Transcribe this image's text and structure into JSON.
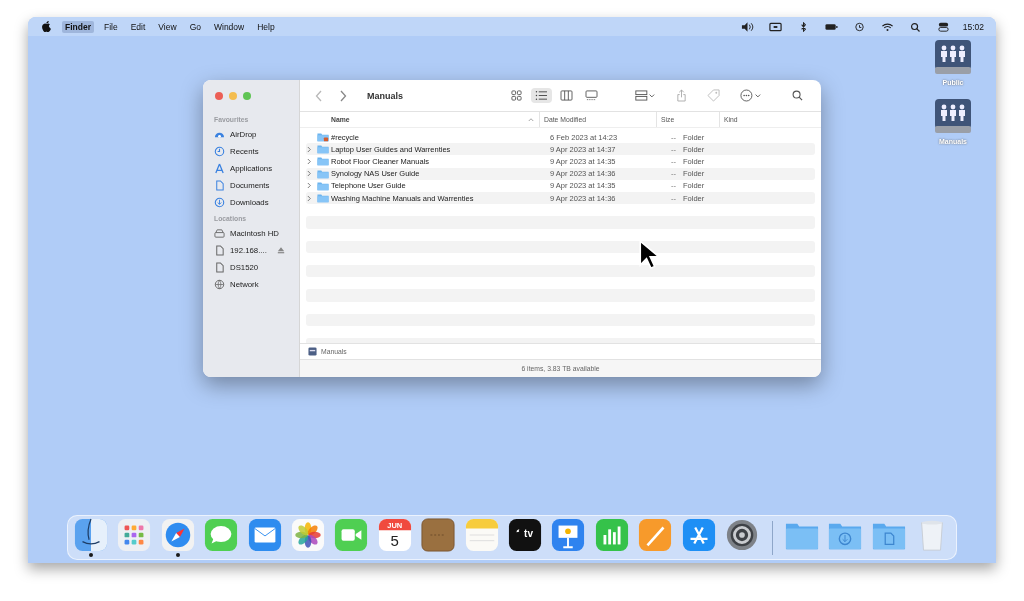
{
  "menu_bar": {
    "menus": [
      {
        "label": "Finder",
        "selected": true
      },
      {
        "label": "File",
        "selected": false
      },
      {
        "label": "Edit",
        "selected": false
      },
      {
        "label": "View",
        "selected": false
      },
      {
        "label": "Go",
        "selected": false
      },
      {
        "label": "Window",
        "selected": false
      },
      {
        "label": "Help",
        "selected": false
      }
    ],
    "clock": "15:02"
  },
  "desktop_icons": [
    {
      "label": "Public"
    },
    {
      "label": "Manuals"
    }
  ],
  "window": {
    "title": "Manuals",
    "view_buttons": [
      {
        "kind": "icons",
        "selected": false
      },
      {
        "kind": "list",
        "selected": true
      },
      {
        "kind": "columns",
        "selected": false
      },
      {
        "kind": "gallery",
        "selected": false
      }
    ],
    "sidebar": [
      {
        "heading": "Favourites",
        "items": [
          {
            "label": "AirDrop",
            "ejectable": false
          },
          {
            "label": "Recents",
            "ejectable": false
          },
          {
            "label": "Applications",
            "ejectable": false
          },
          {
            "label": "Documents",
            "ejectable": false
          },
          {
            "label": "Downloads",
            "ejectable": false
          }
        ]
      },
      {
        "heading": "Locations",
        "items": [
          {
            "label": "Macintosh HD",
            "ejectable": false
          },
          {
            "label": "192.168....",
            "ejectable": true
          },
          {
            "label": "DS1520",
            "ejectable": false
          },
          {
            "label": "Network",
            "ejectable": false
          }
        ]
      }
    ],
    "columns": [
      {
        "label": "Name",
        "sorted": true
      },
      {
        "label": "Date Modified",
        "sorted": false
      },
      {
        "label": "Size",
        "sorted": false
      },
      {
        "label": "Kind",
        "sorted": false
      }
    ],
    "rows": [
      {
        "name": "#recycle",
        "date": "6 Feb 2023 at 14:23",
        "size": "--",
        "kind": "Folder",
        "expandable": false,
        "badged": true
      },
      {
        "name": "Laptop User Guides and Warrenties",
        "date": "9 Apr 2023 at 14:37",
        "size": "--",
        "kind": "Folder",
        "expandable": true,
        "badged": false
      },
      {
        "name": "Robot Floor Cleaner Manuals",
        "date": "9 Apr 2023 at 14:35",
        "size": "--",
        "kind": "Folder",
        "expandable": true,
        "badged": false
      },
      {
        "name": "Synology NAS User Guide",
        "date": "9 Apr 2023 at 14:36",
        "size": "--",
        "kind": "Folder",
        "expandable": true,
        "badged": false
      },
      {
        "name": "Telephone User Guide",
        "date": "9 Apr 2023 at 14:35",
        "size": "--",
        "kind": "Folder",
        "expandable": true,
        "badged": false
      },
      {
        "name": "Washing Machine Manuals and Warrenties",
        "date": "9 Apr 2023 at 14:36",
        "size": "--",
        "kind": "Folder",
        "expandable": true,
        "badged": false
      }
    ],
    "path_bar": "Manuals",
    "status": "6 items, 3.83 TB available"
  },
  "dock": [
    {
      "kind": "finder",
      "running": true
    },
    {
      "kind": "launchpad",
      "running": false
    },
    {
      "kind": "safari",
      "running": true
    },
    {
      "kind": "messages",
      "running": false
    },
    {
      "kind": "mail",
      "running": false
    },
    {
      "kind": "photos",
      "running": false
    },
    {
      "kind": "facetime",
      "running": false
    },
    {
      "kind": "calendar",
      "running": false,
      "month": "JUN",
      "day": "5"
    },
    {
      "kind": "notefile",
      "running": false
    },
    {
      "kind": "notes",
      "running": false
    },
    {
      "kind": "tv",
      "running": false,
      "text": "tv"
    },
    {
      "kind": "keynote",
      "running": false
    },
    {
      "kind": "numbers",
      "running": false
    },
    {
      "kind": "pages",
      "running": false
    },
    {
      "kind": "appstore",
      "running": false
    },
    {
      "kind": "settings",
      "running": false
    },
    {
      "kind": "separator"
    },
    {
      "kind": "folder",
      "running": false
    },
    {
      "kind": "folder-download",
      "running": false
    },
    {
      "kind": "folder-doc",
      "running": false
    },
    {
      "kind": "trash",
      "running": false
    }
  ]
}
